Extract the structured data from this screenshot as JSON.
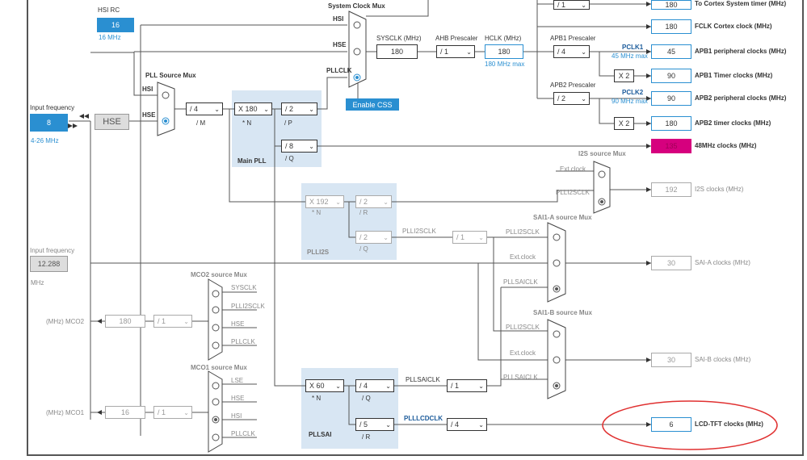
{
  "input_hsi": {
    "label": "HSI RC",
    "value": "16",
    "unit": "16 MHz"
  },
  "input_hse": {
    "label": "Input frequency",
    "value": "8",
    "range": "4-26 MHz",
    "block": "HSE"
  },
  "input_ext": {
    "label": "Input frequency",
    "value": "12.288",
    "unit": "MHz"
  },
  "pll_source_mux": {
    "title": "PLL Source Mux",
    "hsi": "HSI",
    "hse": "HSE"
  },
  "main_pll": {
    "title": "Main PLL",
    "m": "/ 4",
    "m_label": "/ M",
    "n": "X 180",
    "n_label": "* N",
    "p": "/ 2",
    "p_label": "/ P",
    "q": "/ 8",
    "q_label": "/ Q"
  },
  "system_clock_mux": {
    "title": "System Clock Mux",
    "hsi": "HSI",
    "hse": "HSE",
    "pllclk": "PLLCLK",
    "css_button": "Enable CSS"
  },
  "sysclk": {
    "label": "SYSCLK (MHz)",
    "value": "180"
  },
  "ahb": {
    "label": "AHB Prescaler",
    "value": "/ 1"
  },
  "hclk": {
    "label": "HCLK (MHz)",
    "value": "180",
    "max": "180 MHz max"
  },
  "apb1": {
    "label": "APB1 Prescaler",
    "value": "/ 4",
    "pclk": "PCLK1",
    "pclk_max": "45 MHz max",
    "x2": "X 2"
  },
  "apb2": {
    "label": "APB2 Prescaler",
    "value": "/ 2",
    "pclk": "PCLK2",
    "pclk_max": "90 MHz max",
    "x2": "X 2"
  },
  "top_prescaler": "/ 1",
  "outputs": [
    {
      "value": "180",
      "label": "To Cortex System timer (MHz)"
    },
    {
      "value": "180",
      "label": "FCLK Cortex clock (MHz)"
    },
    {
      "value": "45",
      "label": "APB1 peripheral clocks (MHz)"
    },
    {
      "value": "90",
      "label": "APB1 Timer clocks (MHz)"
    },
    {
      "value": "90",
      "label": "APB2 peripheral clocks (MHz)"
    },
    {
      "value": "180",
      "label": "APB2 timer clocks (MHz)"
    },
    {
      "value": "135",
      "label": "48MHz clocks (MHz)"
    },
    {
      "value": "192",
      "label": "I2S clocks (MHz)"
    },
    {
      "value": "30",
      "label": "SAI-A clocks (MHz)"
    },
    {
      "value": "30",
      "label": "SAI-B clocks (MHz)"
    },
    {
      "value": "6",
      "label": "LCD-TFT clocks (MHz)"
    }
  ],
  "i2s_mux": {
    "title": "I2S source Mux",
    "ext": "Ext.clock",
    "plli2sclk": "PLLI2SCLK"
  },
  "plli2s": {
    "title": "PLLI2S",
    "n": "X 192",
    "n_label": "* N",
    "r": "/ 2",
    "r_label": "/ R",
    "q": "/ 2",
    "q_label": "/ Q",
    "clk_label": "PLLI2SCLK",
    "div": "/ 1"
  },
  "sai_a_mux": {
    "title": "SAI1-A source Mux",
    "plli2sclk": "PLLI2SCLK",
    "ext": "Ext.clock",
    "pllsaiclk": "PLLSAICLK"
  },
  "sai_b_mux": {
    "title": "SAI1-B source Mux",
    "plli2sclk": "PLLI2SCLK",
    "ext": "Ext.clock",
    "pllsaiclk": "PLLSAICLK"
  },
  "mco2_mux": {
    "title": "MCO2 source Mux",
    "sysclk": "SYSCLK",
    "plli2sclk": "PLLI2SCLK",
    "hse": "HSE",
    "pllclk": "PLLCLK",
    "out_label": "(MHz) MCO2",
    "value": "180",
    "div": "/ 1"
  },
  "mco1_mux": {
    "title": "MCO1 source Mux",
    "lse": "LSE",
    "hse": "HSE",
    "hsi": "HSI",
    "pllclk": "PLLCLK",
    "out_label": "(MHz) MCO1",
    "value": "16",
    "div": "/ 1"
  },
  "pllsai": {
    "title": "PLLSAI",
    "n": "X 60",
    "n_label": "* N",
    "q": "/ 4",
    "q_label": "/ Q",
    "r": "/ 5",
    "r_label": "/ R",
    "saiclk": "PLLSAICLK",
    "div": "/ 1",
    "lcdclk": "PLLLCDCLK",
    "lcd_div": "/ 4"
  }
}
